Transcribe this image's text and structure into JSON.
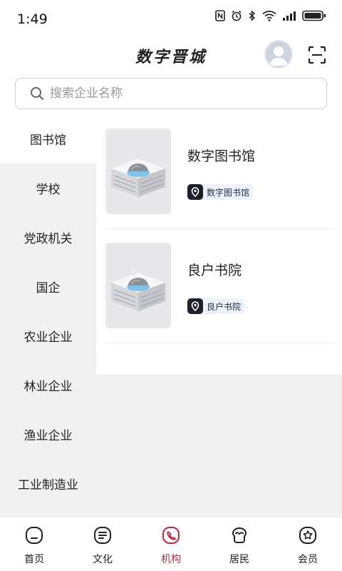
{
  "status_bar": {
    "time": "1:49",
    "icons": [
      "nfc-icon",
      "alarm-icon",
      "bluetooth-icon",
      "wifi-icon",
      "signal-icon",
      "battery-icon"
    ]
  },
  "header": {
    "title": "数字晋城",
    "avatar_icon": "user-avatar",
    "scan_icon": "scan-icon"
  },
  "search": {
    "placeholder": "搜索企业名称",
    "value": ""
  },
  "sidebar": {
    "items": [
      {
        "label": "图书馆",
        "active": true
      },
      {
        "label": "学校",
        "active": false
      },
      {
        "label": "党政机关",
        "active": false
      },
      {
        "label": "国企",
        "active": false
      },
      {
        "label": "农业企业",
        "active": false
      },
      {
        "label": "林业企业",
        "active": false
      },
      {
        "label": "渔业企业",
        "active": false
      },
      {
        "label": "工业制造业",
        "active": false
      }
    ]
  },
  "list": {
    "items": [
      {
        "title": "数字图书馆",
        "tag": "数字图书馆",
        "tag_icon": "location-pin-icon"
      },
      {
        "title": "良户书院",
        "tag": "良户书院",
        "tag_icon": "location-pin-icon"
      }
    ]
  },
  "bottom_nav": {
    "items": [
      {
        "label": "首页",
        "icon": "home-icon",
        "active": false
      },
      {
        "label": "文化",
        "icon": "culture-icon",
        "active": false
      },
      {
        "label": "机构",
        "icon": "organization-icon",
        "active": true
      },
      {
        "label": "居民",
        "icon": "resident-icon",
        "active": false
      },
      {
        "label": "会员",
        "icon": "member-icon",
        "active": false
      }
    ]
  },
  "colors": {
    "accent": "#c2283a",
    "sidebar_bg": "#f1f1f1",
    "tag_bg": "#eef2fa",
    "tag_icon_bg": "#1f1f2e"
  }
}
